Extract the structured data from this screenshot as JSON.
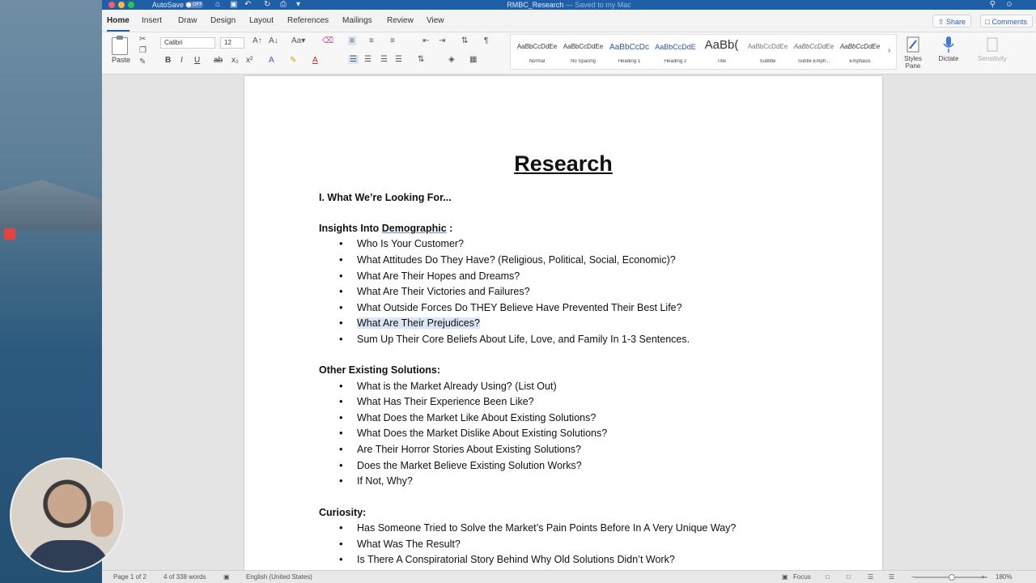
{
  "window": {
    "autosave_label": "AutoSave",
    "autosave_state": "OFF",
    "doc_name": "RMBC_Research",
    "saved_status": "Saved to my Mac"
  },
  "tabs": [
    "Home",
    "Insert",
    "Draw",
    "Design",
    "Layout",
    "References",
    "Mailings",
    "Review",
    "View"
  ],
  "tabs_active": "Home",
  "share_label": "Share",
  "comments_label": "Comments",
  "ribbon": {
    "paste_label": "Paste",
    "font_name": "Calibri",
    "font_size": "12",
    "styles": [
      {
        "sample": "AaBbCcDdEe",
        "name": "Normal"
      },
      {
        "sample": "AaBbCcDdEe",
        "name": "No Spacing"
      },
      {
        "sample": "AaBbCcDc",
        "name": "Heading 1"
      },
      {
        "sample": "AaBbCcDdE",
        "name": "Heading 2"
      },
      {
        "sample": "AaBb(",
        "name": "Title"
      },
      {
        "sample": "AaBbCcDdEe",
        "name": "Subtitle"
      },
      {
        "sample": "AaBbCcDdEe",
        "name": "Subtle Emph..."
      },
      {
        "sample": "AaBbCcDdEe",
        "name": "Emphasis"
      }
    ],
    "styles_pane_label": "Styles Pane",
    "dictate_label": "Dictate",
    "sensitivity_label": "Sensitivity"
  },
  "document": {
    "heading": "Research",
    "section1_title": "I. What We’re Looking For...",
    "section2_prefix": "Insights Into ",
    "section2_ul": "Demographic",
    "section2_suffix": " :",
    "section2_items": [
      "Who Is Your Customer?",
      "What Attitudes Do They Have? (Religious, Political, Social, Economic)?",
      "What Are Their Hopes and Dreams?",
      "What Are Their Victories and Failures?",
      "What Outside Forces Do THEY Believe Have Prevented Their Best Life?",
      "What Are Their Prejudices?",
      "Sum Up Their Core Beliefs About Life, Love, and Family In 1-3 Sentences."
    ],
    "section3_title": "Other Existing Solutions:",
    "section3_items": [
      "What is the Market Already Using? (List Out)",
      "What Has Their Experience Been Like?",
      "What Does the Market Like About Existing Solutions?",
      "What Does the Market Dislike About Existing Solutions?",
      "Are Their Horror Stories About Existing Solutions?",
      "Does the Market Believe Existing Solution Works?",
      "If Not, Why?"
    ],
    "section4_title": "Curiosity:",
    "section4_items": [
      "Has Someone Tried to Solve the Market’s Pain Points Before In A Very Unique Way?",
      "What Was The Result?",
      "Is There A Conspiratorial Story Behind Why Old Solutions Didn’t Work?"
    ]
  },
  "status": {
    "page": "Page 1 of 2",
    "words": "4 of 338 words",
    "language": "English (United States)",
    "focus": "Focus",
    "zoom": "180%"
  }
}
